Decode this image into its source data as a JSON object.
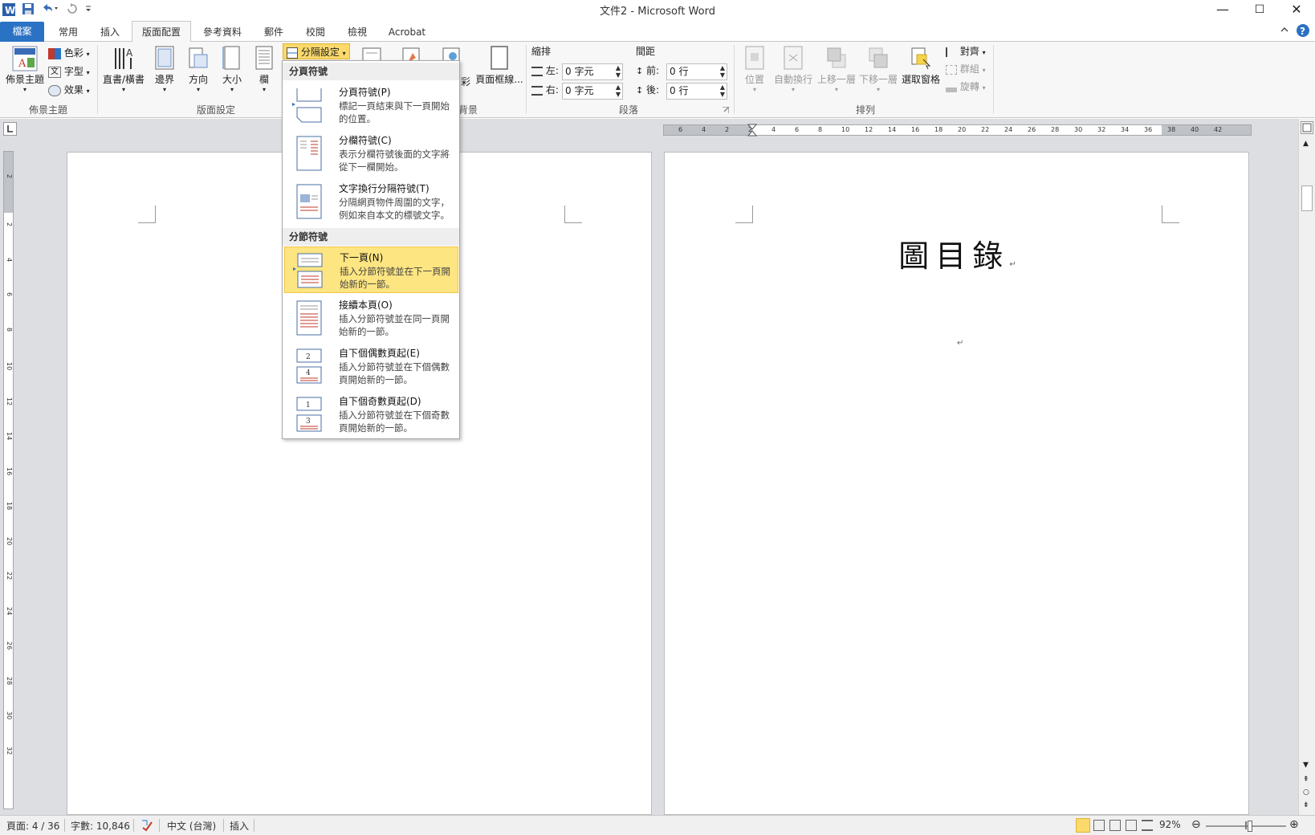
{
  "window": {
    "title": "文件2 - Microsoft Word",
    "minimize": "—",
    "maximize": "☐",
    "close": "✕"
  },
  "tabs": [
    {
      "label": "檔案"
    },
    {
      "label": "常用"
    },
    {
      "label": "插入"
    },
    {
      "label": "版面配置"
    },
    {
      "label": "參考資料"
    },
    {
      "label": "郵件"
    },
    {
      "label": "校閱"
    },
    {
      "label": "檢視"
    },
    {
      "label": "Acrobat"
    }
  ],
  "ribbon": {
    "themes": {
      "label": "佈景主題",
      "button": "佈景主題",
      "colors": "色彩",
      "fonts": "字型",
      "effects": "效果"
    },
    "page_setup": {
      "label": "版面設定",
      "orientation_text": "直書/橫書",
      "margins": "邊界",
      "orientation": "方向",
      "size": "大小",
      "columns": "欄",
      "breaks": "分隔設定"
    },
    "background": {
      "label_partial": "背景",
      "color_partial": "彩",
      "page_borders": "頁面框線..."
    },
    "paragraph": {
      "label": "段落",
      "indent_header": "縮排",
      "spacing_header": "間距",
      "left_label": "左:",
      "left_value": "0 字元",
      "right_label": "右:",
      "right_value": "0 字元",
      "before_label": "前:",
      "before_value": "0 行",
      "after_label": "後:",
      "after_value": "0 行"
    },
    "arrange": {
      "label": "排列",
      "position": "位置",
      "wrap": "自動換行",
      "forward": "上移一層",
      "backward": "下移一層",
      "selection_pane": "選取窗格",
      "align": "對齊",
      "group": "群組",
      "rotate": "旋轉"
    }
  },
  "breaks_menu": {
    "page_breaks_header": "分頁符號",
    "section_breaks_header": "分節符號",
    "items": [
      {
        "title": "分頁符號(P)",
        "desc": "標記一頁結束與下一頁開始的位置。"
      },
      {
        "title": "分欄符號(C)",
        "desc": "表示分欄符號後面的文字將從下一欄開始。"
      },
      {
        "title": "文字換行分隔符號(T)",
        "desc": "分隔網頁物件周圍的文字，例如來自本文的標號文字。"
      },
      {
        "title": "下一頁(N)",
        "desc": "插入分節符號並在下一頁開始新的一節。"
      },
      {
        "title": "接續本頁(O)",
        "desc": "插入分節符號並在同一頁開始新的一節。"
      },
      {
        "title": "自下個偶數頁起(E)",
        "desc": "插入分節符號並在下個偶數頁開始新的一節。"
      },
      {
        "title": "自下個奇數頁起(D)",
        "desc": "插入分節符號並在下個奇數頁開始新的一節。"
      }
    ]
  },
  "ruler": {
    "h_ticks": [
      "6",
      "4",
      "2",
      "2",
      "4",
      "6",
      "8",
      "10",
      "12",
      "14",
      "16",
      "18",
      "20",
      "22",
      "24",
      "26",
      "28",
      "30",
      "32",
      "34",
      "36",
      "38",
      "40",
      "42"
    ],
    "v_ticks": [
      "2",
      "2",
      "4",
      "6",
      "8",
      "10",
      "12",
      "14",
      "16",
      "18",
      "20",
      "22",
      "24",
      "26",
      "28",
      "30",
      "32"
    ]
  },
  "document": {
    "heading": "圖目錄",
    "paragraph_mark": "↵"
  },
  "status": {
    "page": "頁面: 4 / 36",
    "words": "字數: 10,846",
    "language": "中文 (台灣)",
    "mode": "插入",
    "zoom": "92%",
    "zoom_fraction": 0.55
  },
  "colors": {
    "file_tab": "#2a72c4",
    "highlight": "#fde581",
    "breaks_button": "#fbd96b"
  }
}
